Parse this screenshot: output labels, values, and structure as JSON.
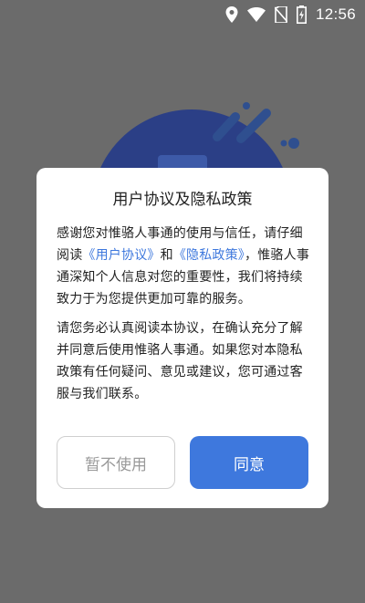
{
  "status_bar": {
    "time": "12:56",
    "icons": [
      "location-icon",
      "wifi-icon",
      "no-sim-icon",
      "battery-charging-icon"
    ]
  },
  "colors": {
    "overlay": "#6b6b6b",
    "accent": "#3e78dd",
    "illustration_navy": "#2b3f86"
  },
  "dialog": {
    "title": "用户协议及隐私政策",
    "paragraph1": {
      "intro": "感谢您对惟骆人事通的使用与信任，请仔细阅读",
      "link_user_agreement": "《用户协议》",
      "and": "和",
      "link_privacy_policy": "《隐私政策》",
      "rest": "，惟骆人事通深知个人信息对您的重要性，我们将持续致力于为您提供更加可靠的服务。"
    },
    "paragraph2": "请您务必认真阅读本协议，在确认充分了解并同意后使用惟骆人事通。如果您对本隐私政策有任何疑问、意见或建议，您可通过客服与我们联系。",
    "decline_label": "暂不使用",
    "agree_label": "同意"
  }
}
